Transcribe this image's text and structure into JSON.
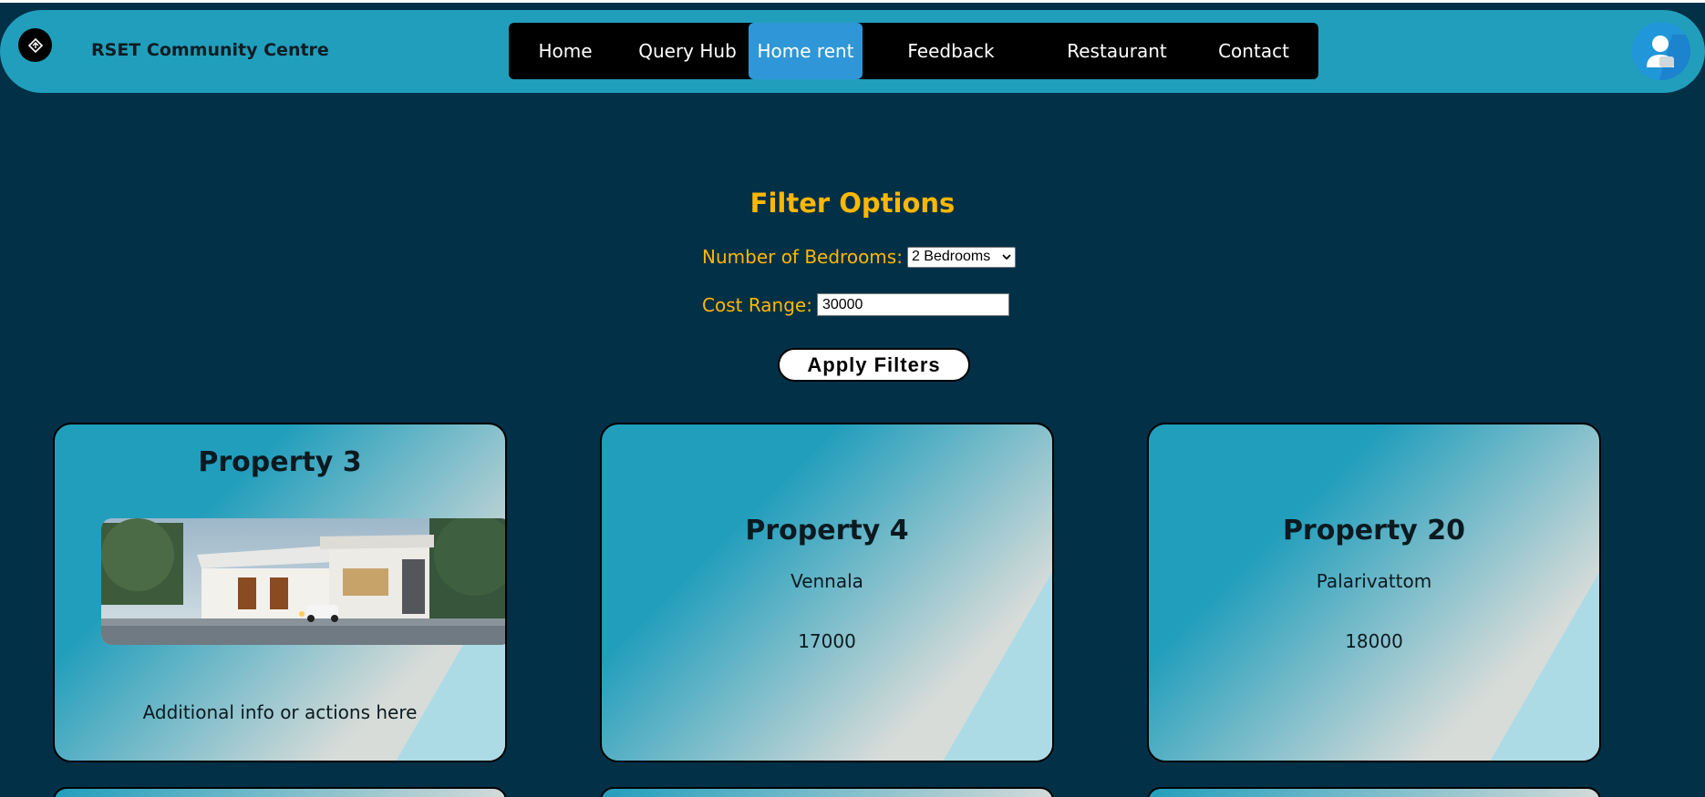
{
  "header": {
    "brand": "RSET Community Centre",
    "nav": [
      "Home",
      "Query Hub",
      "Home rent",
      "Feedback",
      "Restaurant",
      "Contact"
    ],
    "active_nav": "Home rent"
  },
  "filter": {
    "title": "Filter Options",
    "bedrooms_label": "Number of Bedrooms:",
    "bedrooms_value": "2 Bedrooms",
    "cost_label": "Cost Range:",
    "cost_value": "30000",
    "apply_label": "Apply Filters"
  },
  "cards": [
    {
      "title": "Property 3",
      "info": "Additional info or actions here"
    },
    {
      "title": "Property 4",
      "location": "Vennala",
      "price": "17000"
    },
    {
      "title": "Property 20",
      "location": "Palarivattom",
      "price": "18000"
    }
  ],
  "colors": {
    "background": "#023047",
    "header": "#219ebc",
    "accent": "#ffb703",
    "active_tab": "#2f97d7"
  }
}
